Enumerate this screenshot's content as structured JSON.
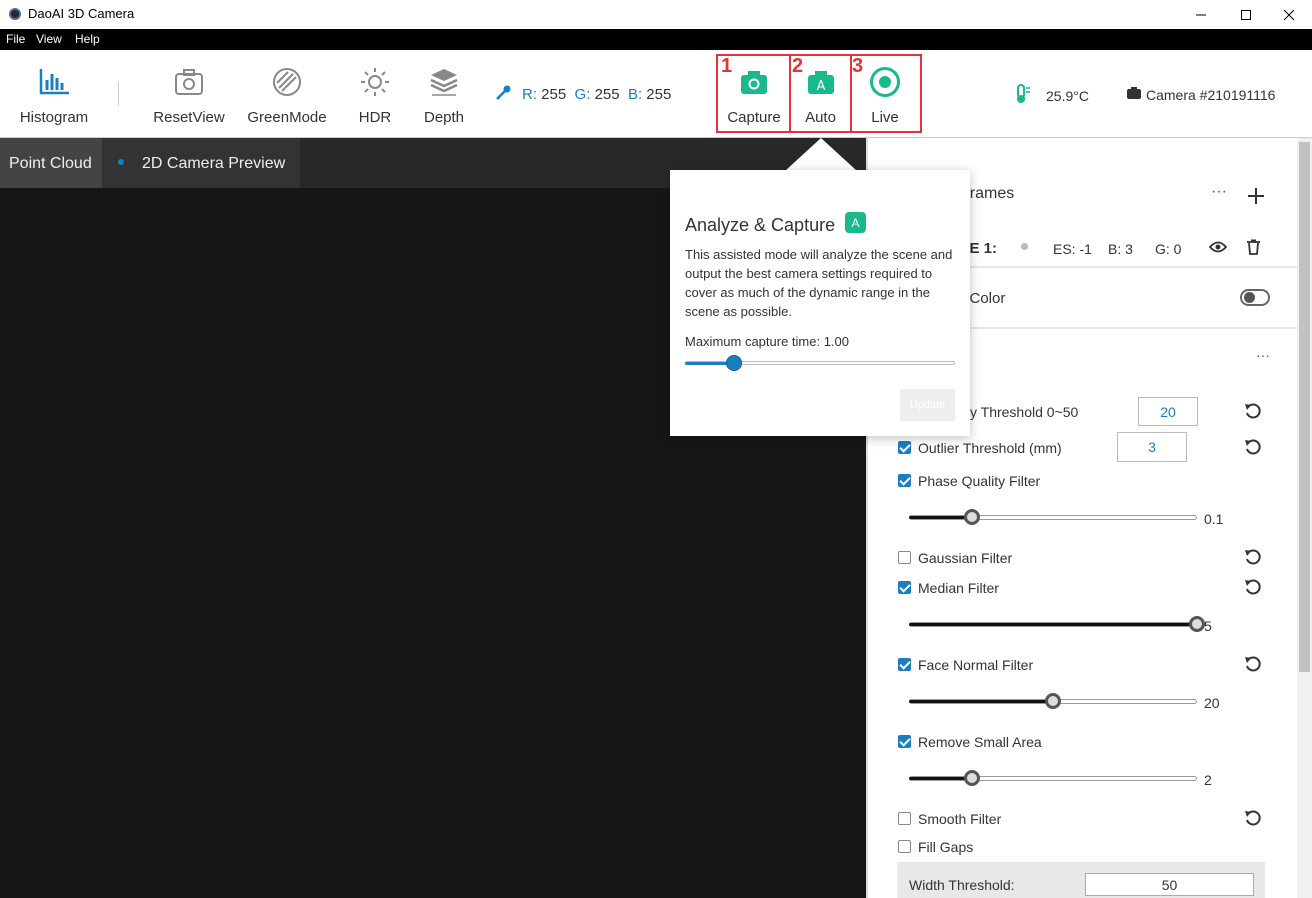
{
  "window": {
    "title": "DaoAI 3D Camera"
  },
  "menu": [
    "File",
    "View",
    "Help"
  ],
  "toolbar": {
    "histogram": "Histogram",
    "resetview": "ResetView",
    "greenmode": "GreenMode",
    "hdr": "HDR",
    "depth": "Depth",
    "rgb": {
      "r_label": "R:",
      "r": "255",
      "g_label": "G:",
      "g": "255",
      "b_label": "B:",
      "b": "255"
    },
    "capture": "Capture",
    "auto": "Auto",
    "live": "Live",
    "temperature": "25.9°C",
    "camera": "Camera #210191116",
    "markers": [
      "1",
      "2",
      "3"
    ]
  },
  "tabs": [
    "Point Cloud",
    "2D Camera Preview"
  ],
  "popup": {
    "title": "Analyze & Capture",
    "badge": "A",
    "description": "This assisted mode will analyze the scene and output the best camera settings required to cover as much of the dynamic range in the scene as possible.",
    "max_capture_label": "Maximum capture time: 1.00",
    "max_capture_value": 0.18,
    "update_button": "Update"
  },
  "panel": {
    "frames_title": "Frames",
    "frame_label": "ME 1:",
    "es": "ES: -1",
    "b": "B: 3",
    "g": "G: 0",
    "color_label": "d Color",
    "filters_header": "s",
    "threshold_label": "y Threshold  0~50",
    "threshold_value": "20",
    "outlier_label": "Outlier Threshold (mm)",
    "outlier_value": "3",
    "phase_label": "Phase Quality Filter",
    "phase_value": "0.1",
    "phase_level": 0.22,
    "gaussian_label": "Gaussian Filter",
    "median_label": "Median Filter",
    "median_value": "5",
    "median_level": 1.0,
    "face_label": "Face Normal Filter",
    "face_value": "20",
    "face_level": 0.5,
    "small_label": "Remove Small Area",
    "small_value": "2",
    "small_level": 0.22,
    "smooth_label": "Smooth Filter",
    "fillgaps_label": "Fill Gaps",
    "width_label": "Width Threshold:",
    "width_value": "50"
  },
  "colors": {
    "accent": "#1a7fc0",
    "green": "#19b98c",
    "marker_red": "#e53238"
  }
}
